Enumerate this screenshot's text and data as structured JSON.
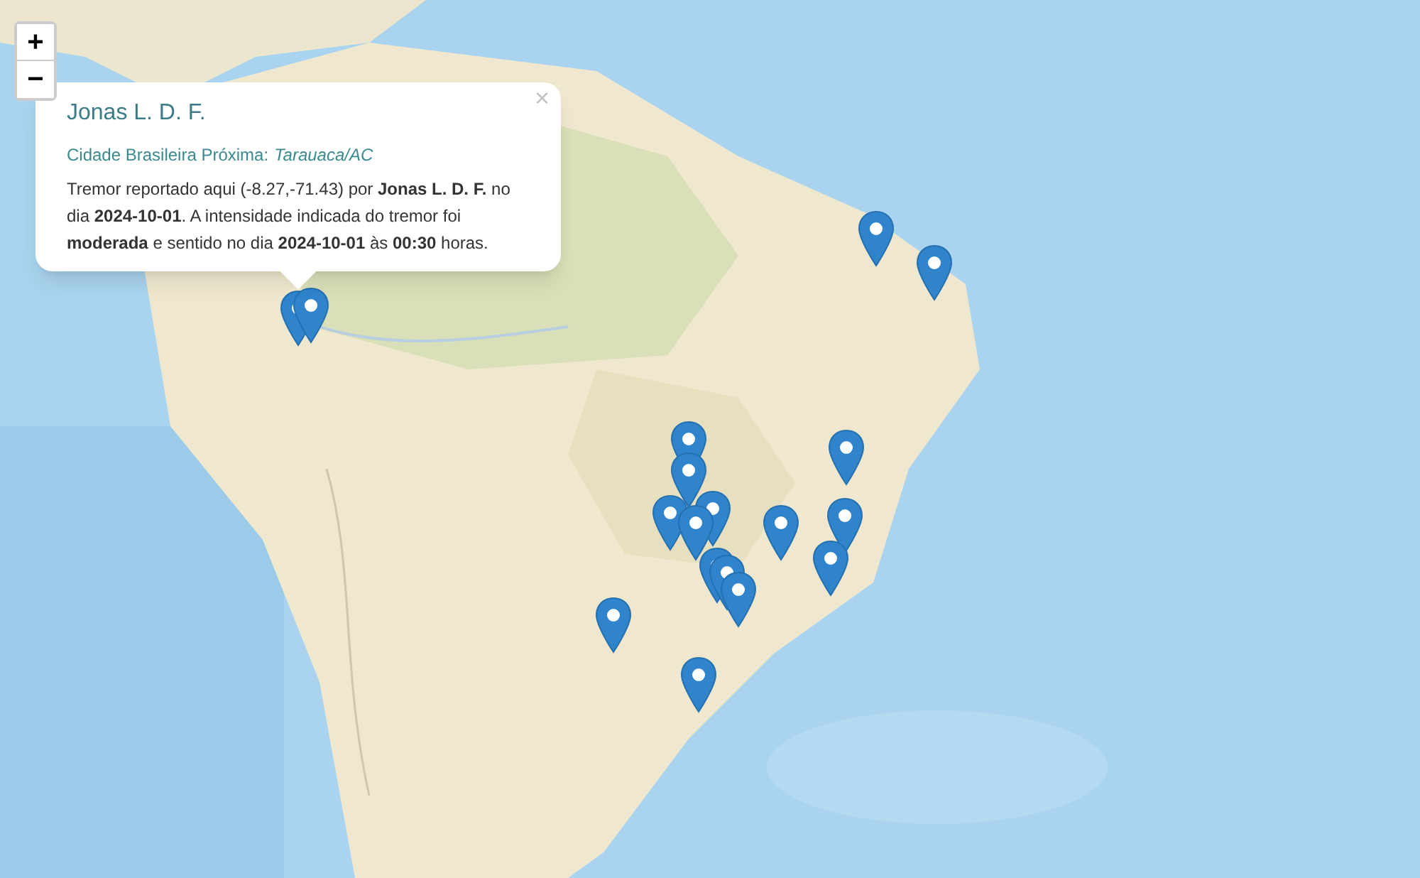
{
  "zoom_controls": [
    {
      "label": "+"
    },
    {
      "label": "−"
    }
  ],
  "popup": {
    "close": "×",
    "title": "Jonas L. D. F.",
    "nearest_city": {
      "label": "Cidade Brasileira Próxima:",
      "value": "Tarauaca/AC"
    },
    "message": "Tremor reportado aqui (-8.27,-71.43) por **Jonas L. D. F.** no dia **2024-10-01**. A intensidade indicada do tremor foi **moderada** e sentido no dia **2024-10-01** às **00:30** horas."
  }
}
